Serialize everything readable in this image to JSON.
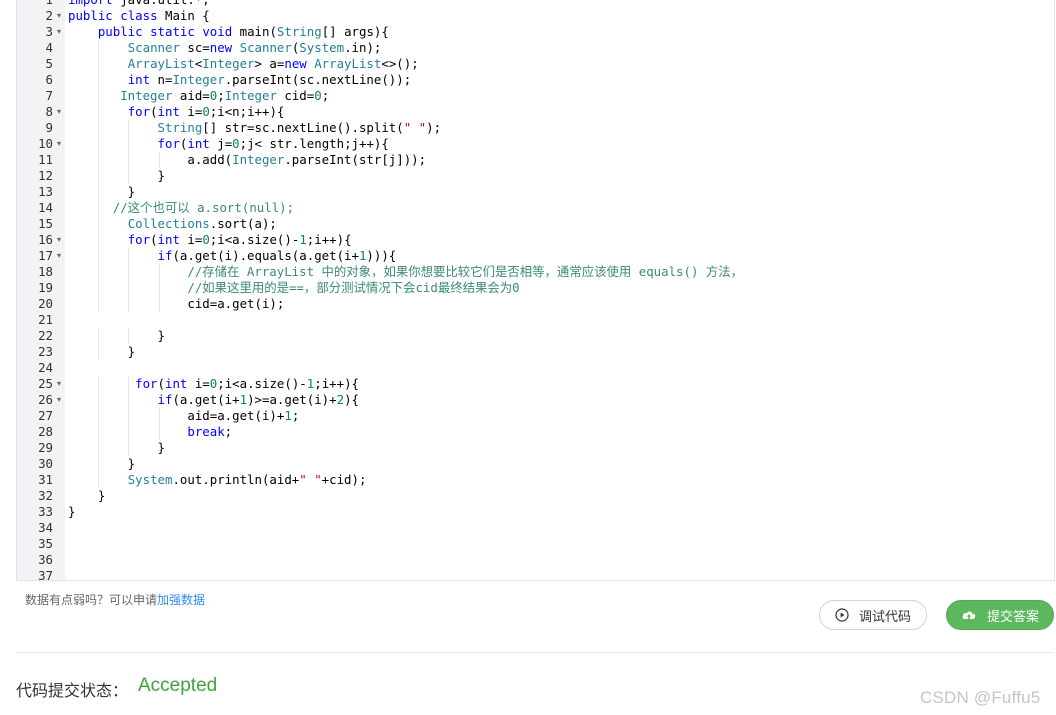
{
  "editor": {
    "lines": [
      {
        "n": "1",
        "fold": false,
        "indent": 0,
        "text": "import java.util.*;"
      },
      {
        "n": "2",
        "fold": true,
        "indent": 0,
        "text": "public class Main {"
      },
      {
        "n": "3",
        "fold": true,
        "indent": 4,
        "text": "public static void main(String[] args){"
      },
      {
        "n": "4",
        "fold": false,
        "indent": 8,
        "text": "Scanner sc=new Scanner(System.in);"
      },
      {
        "n": "5",
        "fold": false,
        "indent": 8,
        "text": "ArrayList<Integer> a=new ArrayList<>();"
      },
      {
        "n": "6",
        "fold": false,
        "indent": 8,
        "text": "int n=Integer.parseInt(sc.nextLine());"
      },
      {
        "n": "7",
        "fold": false,
        "indent": 7,
        "text": "Integer aid=0;Integer cid=0;"
      },
      {
        "n": "8",
        "fold": true,
        "indent": 8,
        "text": "for(int i=0;i<n;i++){"
      },
      {
        "n": "9",
        "fold": false,
        "indent": 12,
        "text": "String[] str=sc.nextLine().split(\" \");"
      },
      {
        "n": "10",
        "fold": true,
        "indent": 12,
        "text": "for(int j=0;j< str.length;j++){"
      },
      {
        "n": "11",
        "fold": false,
        "indent": 16,
        "text": "a.add(Integer.parseInt(str[j]));"
      },
      {
        "n": "12",
        "fold": false,
        "indent": 12,
        "text": "}"
      },
      {
        "n": "13",
        "fold": false,
        "indent": 8,
        "text": "}"
      },
      {
        "n": "14",
        "fold": false,
        "indent": 6,
        "text": "//这个也可以 a.sort(null);"
      },
      {
        "n": "15",
        "fold": false,
        "indent": 8,
        "text": "Collections.sort(a);"
      },
      {
        "n": "16",
        "fold": true,
        "indent": 8,
        "text": "for(int i=0;i<a.size()-1;i++){"
      },
      {
        "n": "17",
        "fold": true,
        "indent": 12,
        "text": "if(a.get(i).equals(a.get(i+1))){"
      },
      {
        "n": "18",
        "fold": false,
        "indent": 16,
        "text": "//存储在 ArrayList 中的对象，如果你想要比较它们是否相等，通常应该使用 equals() 方法，"
      },
      {
        "n": "19",
        "fold": false,
        "indent": 16,
        "text": "//如果这里用的是==，部分测试情况下会cid最终结果会为0"
      },
      {
        "n": "20",
        "fold": false,
        "indent": 16,
        "text": "cid=a.get(i);"
      },
      {
        "n": "21",
        "fold": false,
        "indent": 0,
        "text": ""
      },
      {
        "n": "22",
        "fold": false,
        "indent": 12,
        "text": "}"
      },
      {
        "n": "23",
        "fold": false,
        "indent": 8,
        "text": "}"
      },
      {
        "n": "24",
        "fold": false,
        "indent": 0,
        "text": ""
      },
      {
        "n": "25",
        "fold": true,
        "indent": 9,
        "text": "for(int i=0;i<a.size()-1;i++){"
      },
      {
        "n": "26",
        "fold": true,
        "indent": 12,
        "text": "if(a.get(i+1)>=a.get(i)+2){"
      },
      {
        "n": "27",
        "fold": false,
        "indent": 16,
        "text": "aid=a.get(i)+1;"
      },
      {
        "n": "28",
        "fold": false,
        "indent": 16,
        "text": "break;"
      },
      {
        "n": "29",
        "fold": false,
        "indent": 12,
        "text": "}"
      },
      {
        "n": "30",
        "fold": false,
        "indent": 8,
        "text": "}"
      },
      {
        "n": "31",
        "fold": false,
        "indent": 8,
        "text": "System.out.println(aid+\" \"+cid);"
      },
      {
        "n": "32",
        "fold": false,
        "indent": 4,
        "text": "}"
      },
      {
        "n": "33",
        "fold": false,
        "indent": 0,
        "text": "}"
      },
      {
        "n": "34",
        "fold": false,
        "indent": 0,
        "text": ""
      },
      {
        "n": "35",
        "fold": false,
        "indent": 0,
        "text": ""
      },
      {
        "n": "36",
        "fold": false,
        "indent": 0,
        "text": ""
      },
      {
        "n": "37",
        "fold": false,
        "indent": 0,
        "text": ""
      }
    ]
  },
  "hint": {
    "text": "数据有点弱吗？可以申请",
    "link": "加强数据"
  },
  "buttons": {
    "debug_label": "调试代码",
    "submit_label": "提交答案"
  },
  "status": {
    "label": "代码提交状态：",
    "value": "Accepted"
  },
  "watermark": "CSDN @Fuffu5",
  "colors": {
    "keyword": "#0000ff",
    "number": "#098658",
    "comment": "#3a8a7a",
    "type": "#267f99",
    "accepted": "#3fa33f",
    "submit_bg": "#5cb85c"
  }
}
